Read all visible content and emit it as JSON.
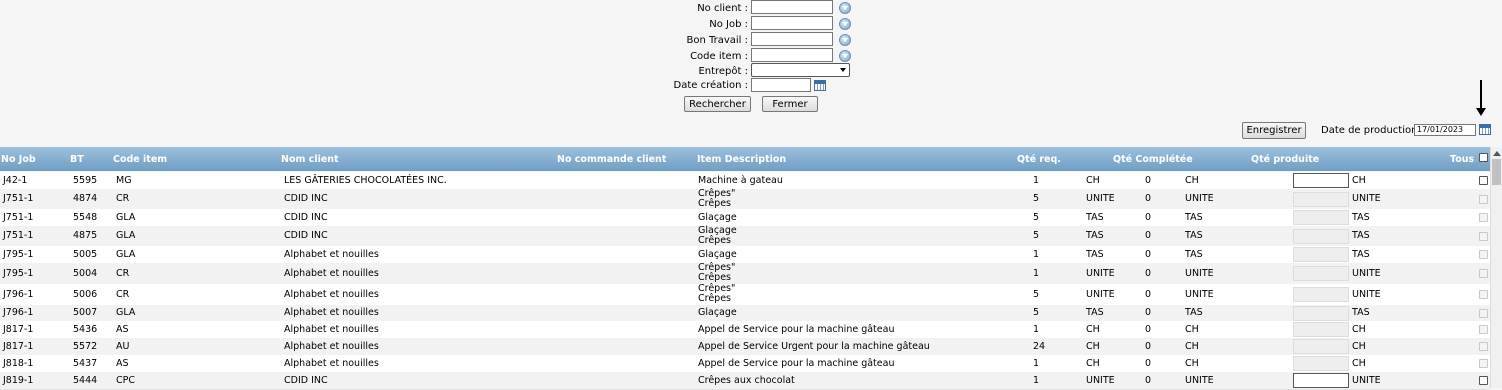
{
  "search": {
    "no_client_label": "No client :",
    "no_job_label": "No Job :",
    "bon_travail_label": "Bon Travail :",
    "code_item_label": "Code item :",
    "entrepot_label": "Entrepôt :",
    "date_creation_label": "Date création :",
    "rechercher_label": "Rechercher",
    "fermer_label": "Fermer"
  },
  "toolbar": {
    "enregistrer_label": "Enregistrer",
    "date_production_label": "Date de production :",
    "date_production_value": "17/01/2023"
  },
  "grid": {
    "headers": {
      "no_job": "No Job",
      "bt": "BT",
      "code_item": "Code item",
      "nom_client": "Nom client",
      "no_commande": "No commande client",
      "item_description": "Item Description",
      "qte_req": "Qté req.",
      "qte_completee": "Qté Complétée",
      "qte_produite": "Qté produite",
      "tous": "Tous"
    },
    "rows": [
      {
        "job": "J42-1",
        "bt": "5595",
        "code": "MG",
        "client": "LES GÂTERIES CHOCOLATÉES INC.",
        "desc1": "Machine à gateau",
        "desc2": "",
        "qreq": "1",
        "unit1": "CH",
        "qcomp": "0",
        "unit2": "CH",
        "unit3": "CH",
        "active": true
      },
      {
        "job": "J751-1",
        "bt": "4874",
        "code": "CR",
        "client": "CDID INC",
        "desc1": "Crêpes\"",
        "desc2": "Crêpes",
        "qreq": "5",
        "unit1": "UNITE",
        "qcomp": "0",
        "unit2": "UNITE",
        "unit3": "UNITE",
        "active": false
      },
      {
        "job": "J751-1",
        "bt": "5548",
        "code": "GLA",
        "client": "CDID INC",
        "desc1": "Glaçage",
        "desc2": "",
        "qreq": "5",
        "unit1": "TAS",
        "qcomp": "0",
        "unit2": "TAS",
        "unit3": "TAS",
        "active": false
      },
      {
        "job": "J751-1",
        "bt": "4875",
        "code": "GLA",
        "client": "CDID INC",
        "desc1": "Glaçage",
        "desc2": "Crêpes",
        "qreq": "5",
        "unit1": "TAS",
        "qcomp": "0",
        "unit2": "TAS",
        "unit3": "TAS",
        "active": false
      },
      {
        "job": "J795-1",
        "bt": "5005",
        "code": "GLA",
        "client": "Alphabet et nouilles",
        "desc1": "Glaçage",
        "desc2": "",
        "qreq": "1",
        "unit1": "TAS",
        "qcomp": "0",
        "unit2": "TAS",
        "unit3": "TAS",
        "active": false
      },
      {
        "job": "J795-1",
        "bt": "5004",
        "code": "CR",
        "client": "Alphabet et nouilles",
        "desc1": "Crêpes\"",
        "desc2": "Crêpes",
        "qreq": "1",
        "unit1": "UNITE",
        "qcomp": "0",
        "unit2": "UNITE",
        "unit3": "UNITE",
        "active": false
      },
      {
        "job": "J796-1",
        "bt": "5006",
        "code": "CR",
        "client": "Alphabet et nouilles",
        "desc1": "Crêpes\"",
        "desc2": "Crêpes",
        "qreq": "5",
        "unit1": "UNITE",
        "qcomp": "0",
        "unit2": "UNITE",
        "unit3": "UNITE",
        "active": false
      },
      {
        "job": "J796-1",
        "bt": "5007",
        "code": "GLA",
        "client": "Alphabet et nouilles",
        "desc1": "Glaçage",
        "desc2": "",
        "qreq": "5",
        "unit1": "TAS",
        "qcomp": "0",
        "unit2": "TAS",
        "unit3": "TAS",
        "active": false
      },
      {
        "job": "J817-1",
        "bt": "5436",
        "code": "AS",
        "client": "Alphabet et nouilles",
        "desc1": "Appel de Service pour la machine gâteau",
        "desc2": "",
        "qreq": "1",
        "unit1": "CH",
        "qcomp": "0",
        "unit2": "CH",
        "unit3": "CH",
        "active": false
      },
      {
        "job": "J817-1",
        "bt": "5572",
        "code": "AU",
        "client": "Alphabet et nouilles",
        "desc1": "Appel de Service Urgent pour la machine gâteau",
        "desc2": "",
        "qreq": "24",
        "unit1": "CH",
        "qcomp": "0",
        "unit2": "CH",
        "unit3": "CH",
        "active": false
      },
      {
        "job": "J818-1",
        "bt": "5437",
        "code": "AS",
        "client": "Alphabet et nouilles",
        "desc1": "Appel de Service pour la machine gâteau",
        "desc2": "",
        "qreq": "1",
        "unit1": "CH",
        "qcomp": "0",
        "unit2": "CH",
        "unit3": "CH",
        "active": false
      },
      {
        "job": "J819-1",
        "bt": "5444",
        "code": "CPC",
        "client": "CDID INC",
        "desc1": "Crêpes aux chocolat",
        "desc2": "",
        "qreq": "1",
        "unit1": "UNITE",
        "qcomp": "0",
        "unit2": "UNITE",
        "unit3": "UNITE",
        "active": true
      }
    ]
  }
}
